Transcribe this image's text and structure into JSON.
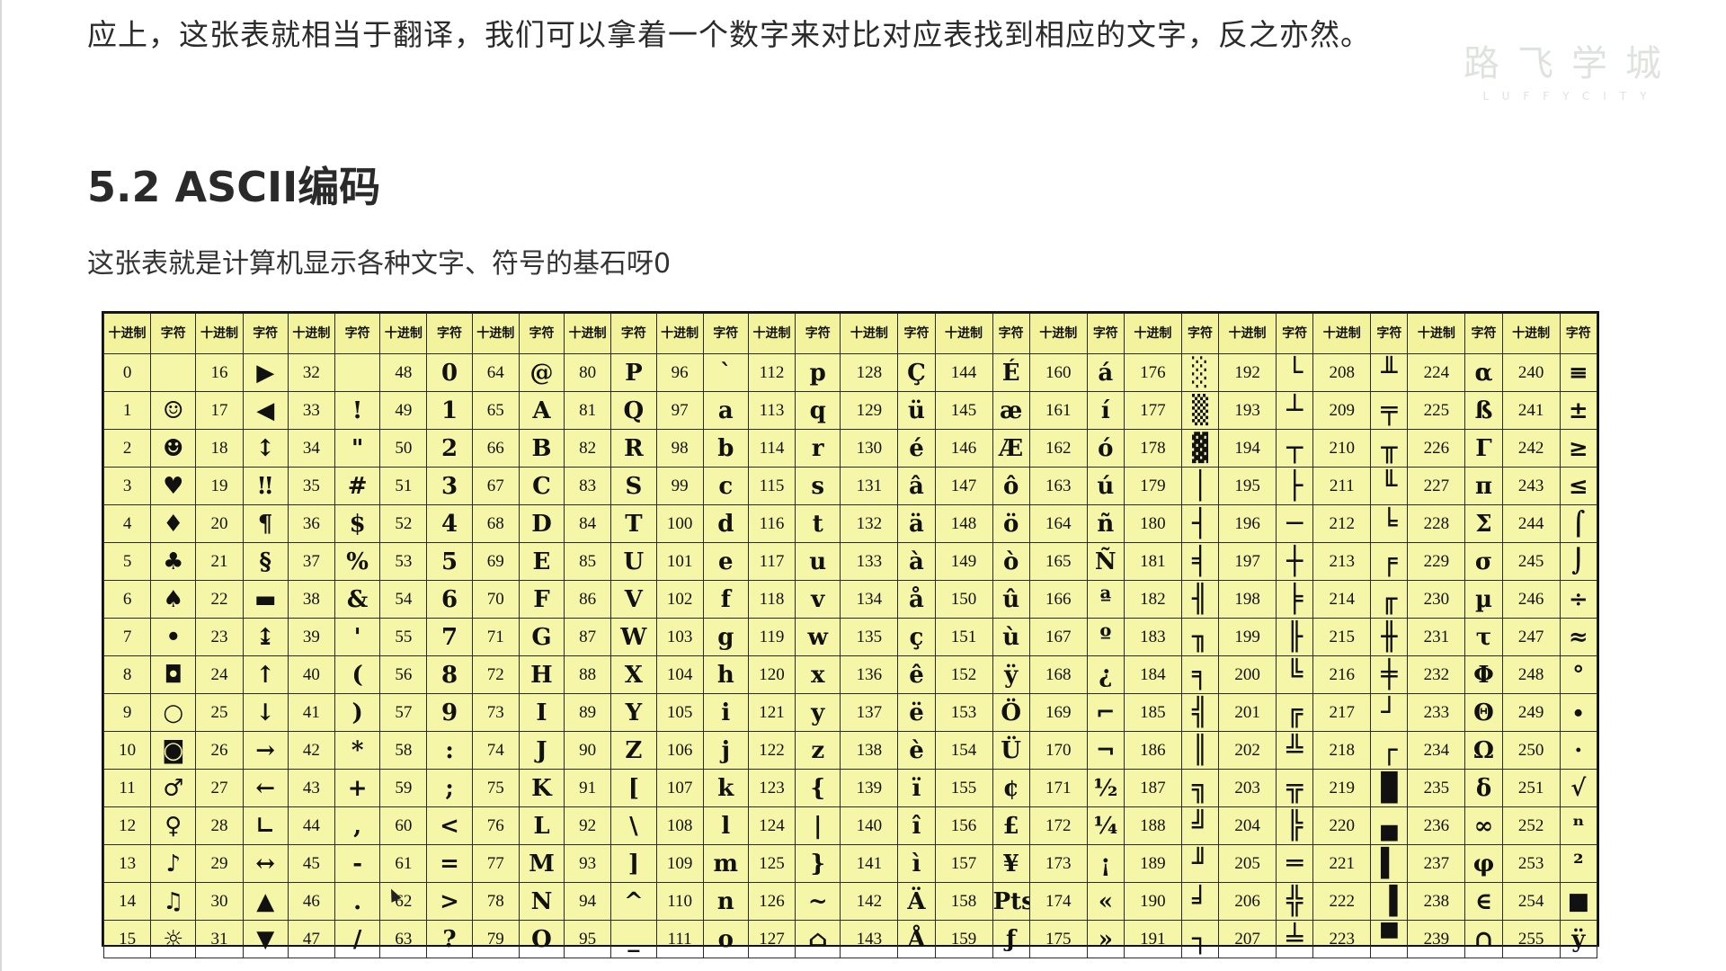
{
  "intro_text": "应上，这张表就相当于翻译，我们可以拿着一个数字来对比对应表找到相应的文字，反之亦然。",
  "watermark": {
    "title": "路飞学城",
    "subtitle": "LUFFYCITY"
  },
  "section_heading": "5.2 ASCII编码",
  "subtitle": "这张表就是计算机显示各种文字、符号的基石呀0",
  "table": {
    "headers": [
      "十进制",
      "字符",
      "十进制",
      "字符",
      "十进制",
      "字符",
      "十进制",
      "字符",
      "十进制",
      "字符",
      "十进制",
      "字符",
      "十进制",
      "字符",
      "十进制",
      "字符",
      "十进制",
      "字符",
      "十进制",
      "字符",
      "十进制",
      "字符",
      "十进制",
      "字符",
      "十进制",
      "字符",
      "十进制",
      "字符",
      "十进制",
      "字符",
      "十进制",
      "字符"
    ],
    "rows": [
      [
        "0",
        "",
        "16",
        "▶",
        "32",
        "",
        "48",
        "0",
        "64",
        "@",
        "80",
        "P",
        "96",
        "`",
        "112",
        "p",
        "128",
        "Ç",
        "144",
        "É",
        "160",
        "á",
        "176",
        "░",
        "192",
        "└",
        "208",
        "╨",
        "224",
        "α",
        "240",
        "≡"
      ],
      [
        "1",
        "☺",
        "17",
        "◀",
        "33",
        "!",
        "49",
        "1",
        "65",
        "A",
        "81",
        "Q",
        "97",
        "a",
        "113",
        "q",
        "129",
        "ü",
        "145",
        "æ",
        "161",
        "í",
        "177",
        "▒",
        "193",
        "┴",
        "209",
        "╤",
        "225",
        "ß",
        "241",
        "±"
      ],
      [
        "2",
        "☻",
        "18",
        "↕",
        "34",
        "\"",
        "50",
        "2",
        "66",
        "B",
        "82",
        "R",
        "98",
        "b",
        "114",
        "r",
        "130",
        "é",
        "146",
        "Æ",
        "162",
        "ó",
        "178",
        "▓",
        "194",
        "┬",
        "210",
        "╥",
        "226",
        "Γ",
        "242",
        "≥"
      ],
      [
        "3",
        "♥",
        "19",
        "‼",
        "35",
        "#",
        "51",
        "3",
        "67",
        "C",
        "83",
        "S",
        "99",
        "c",
        "115",
        "s",
        "131",
        "â",
        "147",
        "ô",
        "163",
        "ú",
        "179",
        "│",
        "195",
        "├",
        "211",
        "╙",
        "227",
        "π",
        "243",
        "≤"
      ],
      [
        "4",
        "♦",
        "20",
        "¶",
        "36",
        "$",
        "52",
        "4",
        "68",
        "D",
        "84",
        "T",
        "100",
        "d",
        "116",
        "t",
        "132",
        "ä",
        "148",
        "ö",
        "164",
        "ñ",
        "180",
        "┤",
        "196",
        "─",
        "212",
        "╘",
        "228",
        "Σ",
        "244",
        "⌠"
      ],
      [
        "5",
        "♣",
        "21",
        "§",
        "37",
        "%",
        "53",
        "5",
        "69",
        "E",
        "85",
        "U",
        "101",
        "e",
        "117",
        "u",
        "133",
        "à",
        "149",
        "ò",
        "165",
        "Ñ",
        "181",
        "╡",
        "197",
        "┼",
        "213",
        "╒",
        "229",
        "σ",
        "245",
        "⌡"
      ],
      [
        "6",
        "♠",
        "22",
        "▬",
        "38",
        "&",
        "54",
        "6",
        "70",
        "F",
        "86",
        "V",
        "102",
        "f",
        "118",
        "v",
        "134",
        "å",
        "150",
        "û",
        "166",
        "ª",
        "182",
        "╢",
        "198",
        "╞",
        "214",
        "╓",
        "230",
        "µ",
        "246",
        "÷"
      ],
      [
        "7",
        "•",
        "23",
        "↨",
        "39",
        "'",
        "55",
        "7",
        "71",
        "G",
        "87",
        "W",
        "103",
        "g",
        "119",
        "w",
        "135",
        "ç",
        "151",
        "ù",
        "167",
        "º",
        "183",
        "╖",
        "199",
        "╟",
        "215",
        "╫",
        "231",
        "τ",
        "247",
        "≈"
      ],
      [
        "8",
        "◘",
        "24",
        "↑",
        "40",
        "(",
        "56",
        "8",
        "72",
        "H",
        "88",
        "X",
        "104",
        "h",
        "120",
        "x",
        "136",
        "ê",
        "152",
        "ÿ",
        "168",
        "¿",
        "184",
        "╕",
        "200",
        "╚",
        "216",
        "╪",
        "232",
        "Φ",
        "248",
        "°"
      ],
      [
        "9",
        "○",
        "25",
        "↓",
        "41",
        ")",
        "57",
        "9",
        "73",
        "I",
        "89",
        "Y",
        "105",
        "i",
        "121",
        "y",
        "137",
        "ë",
        "153",
        "Ö",
        "169",
        "⌐",
        "185",
        "╣",
        "201",
        "╔",
        "217",
        "┘",
        "233",
        "Θ",
        "249",
        "∙"
      ],
      [
        "10",
        "◙",
        "26",
        "→",
        "42",
        "*",
        "58",
        ":",
        "74",
        "J",
        "90",
        "Z",
        "106",
        "j",
        "122",
        "z",
        "138",
        "è",
        "154",
        "Ü",
        "170",
        "¬",
        "186",
        "║",
        "202",
        "╩",
        "218",
        "┌",
        "234",
        "Ω",
        "250",
        "·"
      ],
      [
        "11",
        "♂",
        "27",
        "←",
        "43",
        "+",
        "59",
        ";",
        "75",
        "K",
        "91",
        "[",
        "107",
        "k",
        "123",
        "{",
        "139",
        "ï",
        "155",
        "¢",
        "171",
        "½",
        "187",
        "╗",
        "203",
        "╦",
        "219",
        "█",
        "235",
        "δ",
        "251",
        "√"
      ],
      [
        "12",
        "♀",
        "28",
        "∟",
        "44",
        ",",
        "60",
        "<",
        "76",
        "L",
        "92",
        "\\",
        "108",
        "l",
        "124",
        "|",
        "140",
        "î",
        "156",
        "£",
        "172",
        "¼",
        "188",
        "╝",
        "204",
        "╠",
        "220",
        "▄",
        "236",
        "∞",
        "252",
        "ⁿ"
      ],
      [
        "13",
        "♪",
        "29",
        "↔",
        "45",
        "-",
        "61",
        "=",
        "77",
        "M",
        "93",
        "]",
        "109",
        "m",
        "125",
        "}",
        "141",
        "ì",
        "157",
        "¥",
        "173",
        "¡",
        "189",
        "╜",
        "205",
        "═",
        "221",
        "▌",
        "237",
        "φ",
        "253",
        "²"
      ],
      [
        "14",
        "♫",
        "30",
        "▲",
        "46",
        ".",
        "62",
        ">",
        "78",
        "N",
        "94",
        "^",
        "110",
        "n",
        "126",
        "~",
        "142",
        "Ä",
        "158",
        "Pts",
        "174",
        "«",
        "190",
        "╛",
        "206",
        "╬",
        "222",
        "▐",
        "238",
        "∈",
        "254",
        "■"
      ],
      [
        "15",
        "☼",
        "31",
        "▼",
        "47",
        "/",
        "63",
        "?",
        "79",
        "O",
        "95",
        "_",
        "111",
        "o",
        "127",
        "⌂",
        "143",
        "Å",
        "159",
        "ƒ",
        "175",
        "»",
        "191",
        "┐",
        "207",
        "╧",
        "223",
        "▀",
        "239",
        "∩",
        "255",
        "ÿ"
      ]
    ]
  }
}
